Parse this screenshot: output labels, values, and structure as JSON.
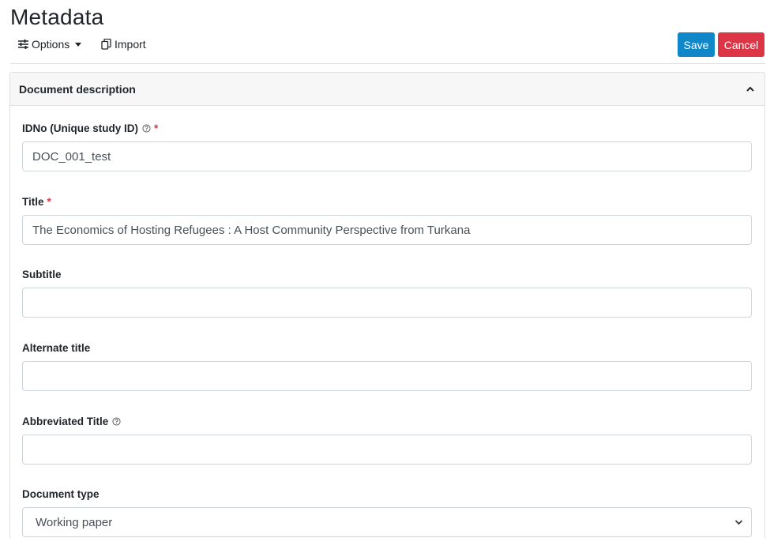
{
  "page": {
    "title": "Metadata"
  },
  "toolbar": {
    "options_label": "Options",
    "import_label": "Import",
    "save_label": "Save",
    "cancel_label": "Cancel"
  },
  "section": {
    "title": "Document description"
  },
  "fields": {
    "idno": {
      "label": "IDNo (Unique study ID)",
      "required_mark": "*",
      "value": "DOC_001_test"
    },
    "title": {
      "label": "Title",
      "required_mark": "*",
      "value": "The Economics of Hosting Refugees : A Host Community Perspective from Turkana"
    },
    "subtitle": {
      "label": "Subtitle",
      "value": ""
    },
    "alternate_title": {
      "label": "Alternate title",
      "value": ""
    },
    "abbreviated_title": {
      "label": "Abbreviated Title",
      "value": ""
    },
    "document_type": {
      "label": "Document type",
      "selected": "Working paper"
    }
  },
  "icons": {
    "options": "sliders-icon",
    "import": "copy-icon",
    "help": "question-circle-icon",
    "collapse": "chevron-up-icon",
    "select": "chevron-down-icon"
  },
  "colors": {
    "primary": "#0f87c9",
    "danger": "#dc3545",
    "header_bg": "#f7f7f7",
    "border": "#ced4da"
  }
}
